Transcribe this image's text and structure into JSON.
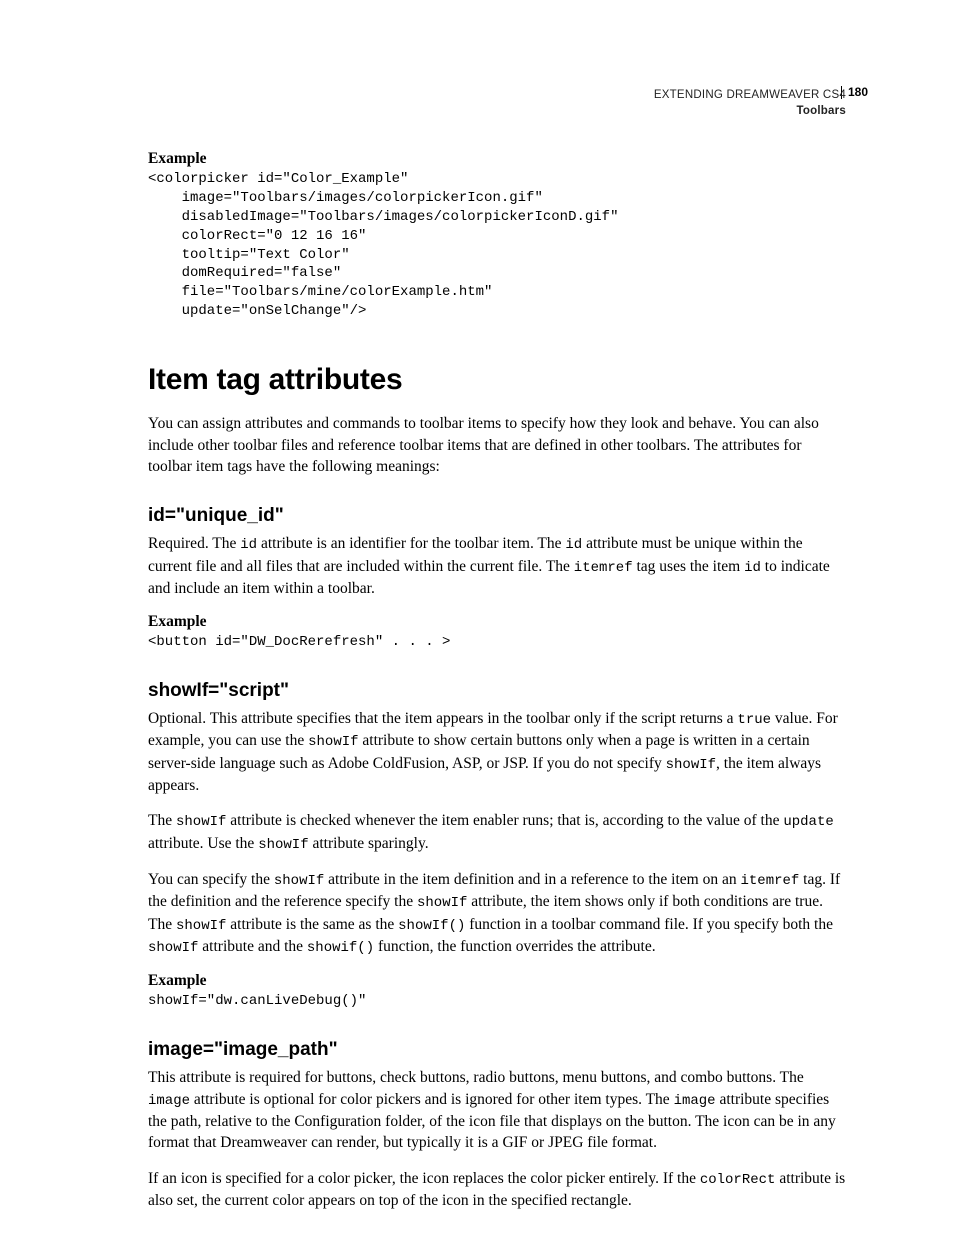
{
  "header": {
    "book_title": "EXTENDING DREAMWEAVER CS4",
    "section": "Toolbars",
    "page_number": "180"
  },
  "example1": {
    "label": "Example",
    "code": "<colorpicker id=\"Color_Example\"\n    image=\"Toolbars/images/colorpickerIcon.gif\"\n    disabledImage=\"Toolbars/images/colorpickerIconD.gif\"\n    colorRect=\"0 12 16 16\"\n    tooltip=\"Text Color\"\n    domRequired=\"false\"\n    file=\"Toolbars/mine/colorExample.htm\"\n    update=\"onSelChange\"/>"
  },
  "h1": "Item tag attributes",
  "intro": " You can assign attributes and commands to toolbar items to specify how they look and behave. You can also include other toolbar files and reference toolbar items that are defined in other toolbars. The attributes for toolbar item tags have the following meanings:",
  "sec_id": {
    "heading": "id=\"unique_id\"",
    "p1a": "Required. The ",
    "c1": "id",
    "p1b": " attribute is an identifier for the toolbar item. The ",
    "c2": "id",
    "p1c": " attribute must be unique within the current file and all files that are included within the current file. The ",
    "c3": "itemref",
    "p1d": " tag uses the item ",
    "c4": "id",
    "p1e": " to indicate and include an item within a toolbar.",
    "ex_label": "Example",
    "ex_code": "<button id=\"DW_DocRerefresh\" . . . >"
  },
  "sec_showif": {
    "heading": "showIf=\"script\"",
    "p1a": "Optional. This attribute specifies that the item appears in the toolbar only if the script returns a ",
    "c1": "true",
    "p1b": " value. For example, you can use the ",
    "c2": "showIf",
    "p1c": " attribute to show certain buttons only when a page is written in a certain server-side language such as Adobe ColdFusion, ASP, or JSP. If you do not specify ",
    "c3": "showIf",
    "p1d": ", the item always appears.",
    "p2a": "The ",
    "c4": "showIf",
    "p2b": " attribute is checked whenever the item enabler runs; that is, according to the value of the ",
    "c5": "update",
    "p2c": " attribute. Use the ",
    "c6": "showIf",
    "p2d": " attribute sparingly.",
    "p3a": "You can specify the ",
    "c7": "showIf",
    "p3b": " attribute in the item definition and in a reference to the item on an ",
    "c8": "itemref",
    "p3c": " tag. If the definition and the reference specify the ",
    "c9": "showIf",
    "p3d": " attribute, the item shows only if both conditions are true. The ",
    "c10": "showIf",
    "p3e": " attribute is the same as the ",
    "c11": "showIf()",
    "p3f": " function in a toolbar command file. If you specify both the ",
    "c12": "showIf",
    "p3g": " attribute and the ",
    "c13": "showif()",
    "p3h": " function, the function overrides the attribute.",
    "ex_label": "Example",
    "ex_code": "showIf=\"dw.canLiveDebug()\""
  },
  "sec_image": {
    "heading": "image=\"image_path\"",
    "p1a": "This attribute is required for buttons, check buttons, radio buttons, menu buttons, and combo buttons. The ",
    "c1": "image",
    "p1b": " attribute is optional for color pickers and is ignored for other item types. The ",
    "c2": "image",
    "p1c": " attribute specifies the path, relative to the Configuration folder, of the icon file that displays on the button. The icon can be in any format that Dreamweaver can render, but typically it is a GIF or JPEG file format.",
    "p2a": "If an icon is specified for a color picker, the icon replaces the color picker entirely. If the ",
    "c3": "colorRect",
    "p2b": " attribute is also set, the current color appears on top of the icon in the specified rectangle."
  }
}
